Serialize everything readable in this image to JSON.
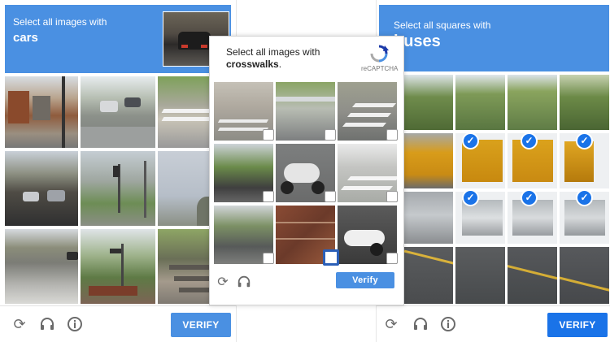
{
  "left": {
    "prompt": "Select all images with",
    "object": "cars",
    "verify": "VERIFY"
  },
  "middle": {
    "prompt": "Select all images with",
    "object": "crosswalks",
    "suffix": ".",
    "brand": "reCAPTCHA",
    "verify": "Verify"
  },
  "right": {
    "prompt": "Select all squares with",
    "object": "buses",
    "verify": "VERIFY"
  },
  "icons": {
    "reload": "reload-icon",
    "audio": "headphones-icon",
    "info": "info-icon",
    "recaptcha": "recaptcha-logo-icon",
    "check": "checkmark-icon"
  },
  "colors": {
    "accent": "#4a90e2",
    "check": "#1a73e8",
    "selected_border": "#2b5fb7"
  }
}
